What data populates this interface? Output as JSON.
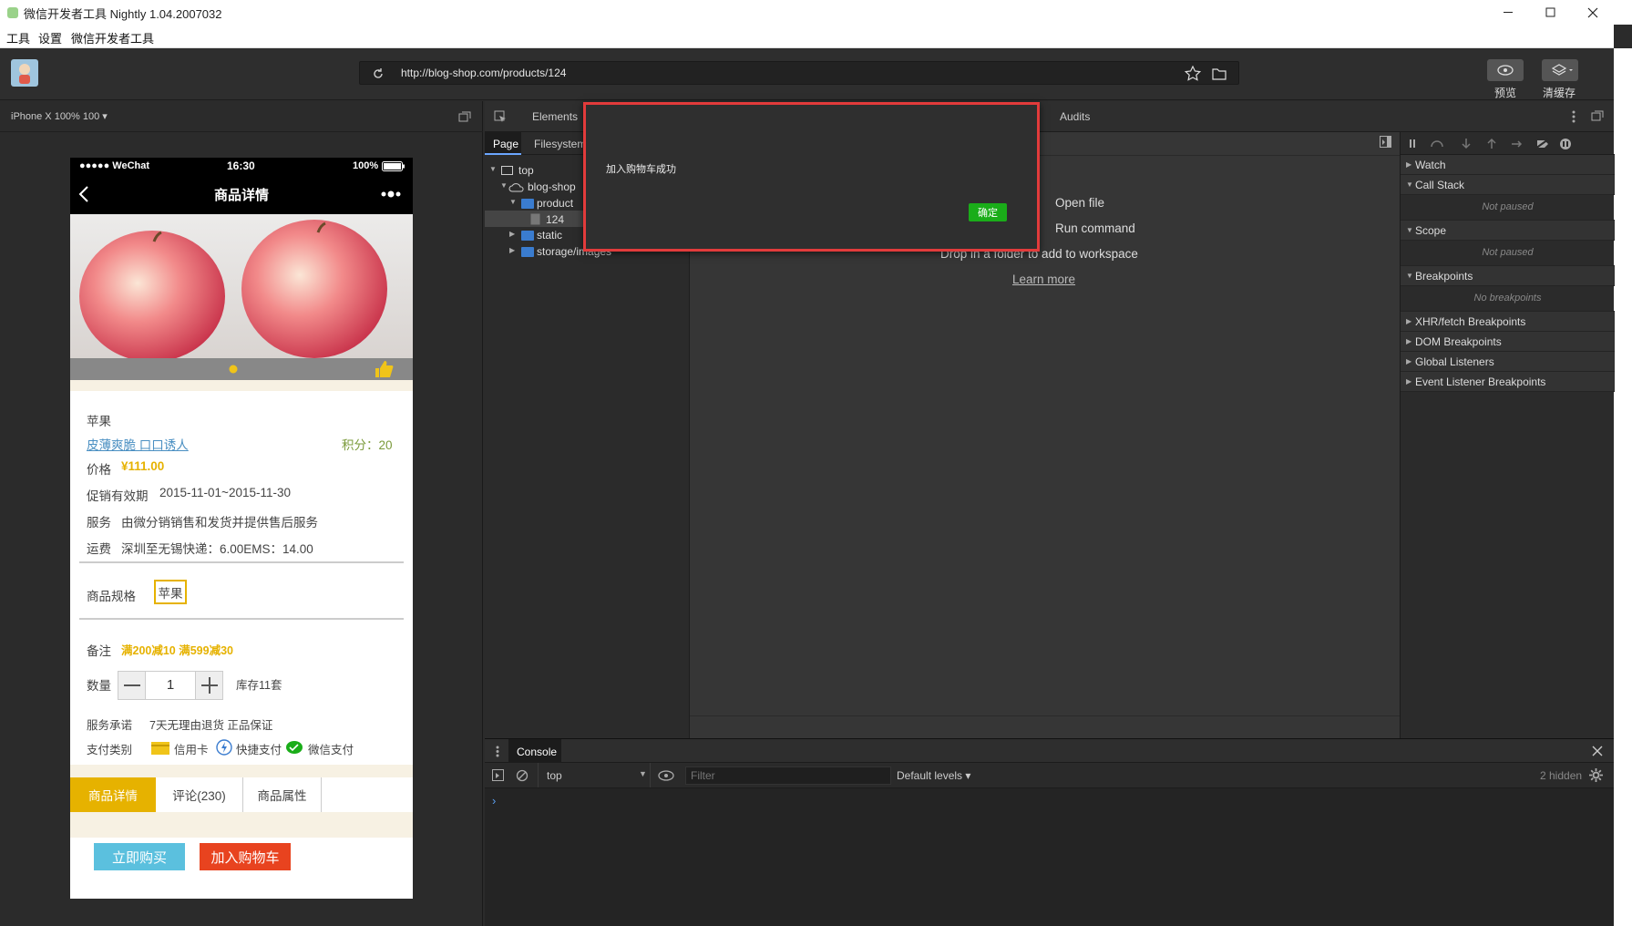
{
  "window": {
    "title": "微信开发者工具 Nightly 1.04.2007032"
  },
  "menu": [
    "工具",
    "设置",
    "微信开发者工具"
  ],
  "toolbar": {
    "url": "http://blog-shop.com/products/124",
    "preview_label": "预览",
    "clear_cache_label": "清缓存"
  },
  "simulator": {
    "device": "iPhone X 100% 100 ▾"
  },
  "phone": {
    "status": {
      "carrier": "●●●●● WeChat",
      "time": "16:30",
      "battery": "100%"
    },
    "nav_title": "商品详情",
    "product_name": "苹果",
    "slogan": "皮薄爽脆 口口诱人",
    "points": "积分：20",
    "price_label": "价格",
    "price": "¥111.00",
    "promo_label": "促销有效期",
    "promo": "2015-11-01~2015-11-30",
    "service_label": "服务",
    "service": "由微分销销售和发货并提供售后服务",
    "shipping_label": "运费",
    "shipping": "深圳至无锡快递：6.00EMS：14.00",
    "spec_label": "商品规格",
    "spec_value": "苹果",
    "note_label": "备注",
    "note": "满200减10 满599减30",
    "qty_label": "数量",
    "qty": "1",
    "stock": "库存11套",
    "promise_label": "服务承诺",
    "promise": "7天无理由退货 正品保证",
    "pay_label": "支付类别",
    "pay_credit": "信用卡",
    "pay_quick": "快捷支付",
    "pay_wechat": "微信支付",
    "tabs": [
      "商品详情",
      "评论(230)",
      "商品属性"
    ],
    "buy_now": "立即购买",
    "add_cart": "加入购物车"
  },
  "devtools": {
    "tabs": [
      "Elements",
      "Audits"
    ],
    "subtabs": [
      "Page",
      "Filesystem"
    ],
    "tree": [
      "top",
      "blog-shop",
      "product",
      "124",
      "static",
      "storage/images"
    ],
    "editor_hints": [
      "Open file",
      "Run command",
      "Drop in a folder to add to workspace",
      "Learn more"
    ],
    "sections": [
      "Watch",
      "Call Stack",
      "Scope",
      "Breakpoints",
      "XHR/fetch Breakpoints",
      "DOM Breakpoints",
      "Global Listeners",
      "Event Listener Breakpoints"
    ],
    "not_paused": "Not paused",
    "no_breakpoints": "No breakpoints",
    "console": {
      "tab": "Console",
      "context": "top",
      "filter_placeholder": "Filter",
      "levels": "Default levels ▾",
      "hidden": "2 hidden"
    }
  },
  "dialog": {
    "message": "加入购物车成功",
    "ok": "确定"
  }
}
